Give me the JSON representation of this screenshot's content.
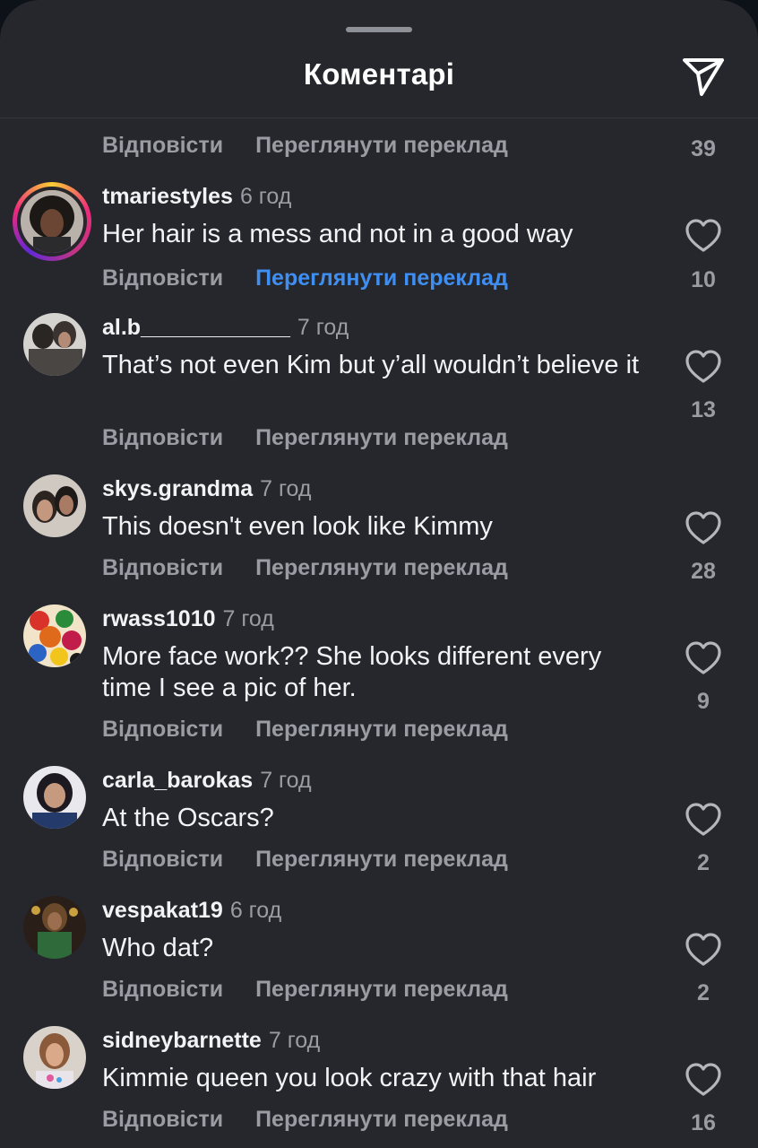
{
  "header": {
    "title": "Коментарі"
  },
  "first_row": {
    "reply_label": "Відповісти",
    "translate_label": "Переглянути переклад",
    "likes": "39"
  },
  "comments": [
    {
      "username": "tmariestyles",
      "time": "6 год",
      "text": "Her hair is a mess and not in a good way",
      "reply_label": "Відповісти",
      "translate_label": "Переглянути переклад",
      "likes": "10",
      "has_story": true,
      "translate_active": true
    },
    {
      "username": "al.b____________",
      "time": "7 год",
      "text": "That’s not even Kim but y’all wouldn’t believe it",
      "reply_label": "Відповісти",
      "translate_label": "Переглянути переклад",
      "likes": "13"
    },
    {
      "username": "skys.grandma",
      "time": "7 год",
      "text": "This doesn't even look like Kimmy",
      "reply_label": "Відповісти",
      "translate_label": "Переглянути переклад",
      "likes": "28"
    },
    {
      "username": "rwass1010",
      "time": "7 год",
      "text": "More face work?? She looks different every time I see a pic of her.",
      "reply_label": "Відповісти",
      "translate_label": "Переглянути переклад",
      "likes": "9"
    },
    {
      "username": "carla_barokas",
      "time": "7 год",
      "text": "At the Oscars?",
      "reply_label": "Відповісти",
      "translate_label": "Переглянути переклад",
      "likes": "2"
    },
    {
      "username": "vespakat19",
      "time": "6 год",
      "text": "Who dat?",
      "reply_label": "Відповісти",
      "translate_label": "Переглянути переклад",
      "likes": "2"
    },
    {
      "username": "sidneybarnette",
      "time": "7 год",
      "text": "Kimmie queen you look crazy with that hair",
      "reply_label": "Відповісти",
      "translate_label": "Переглянути переклад",
      "likes": "16"
    }
  ],
  "icons": {
    "send": "send-icon",
    "like": "heart-outline-icon"
  },
  "colors": {
    "background": "#26272c",
    "text": "#f2f3f5",
    "muted": "#9a9ca3",
    "accent": "#3f8ef1"
  }
}
